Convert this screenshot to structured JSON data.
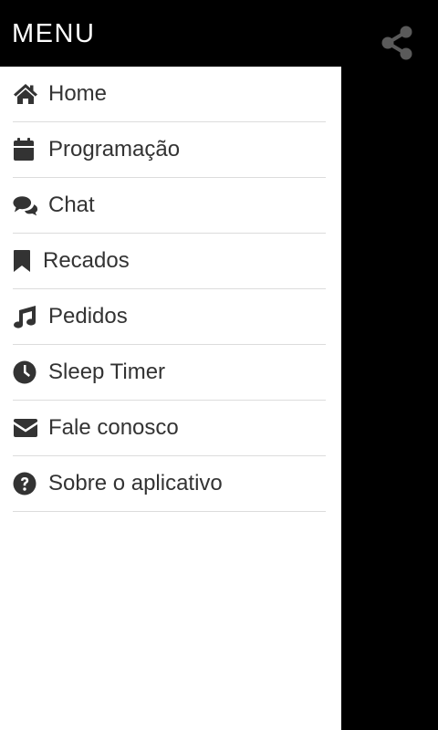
{
  "drawer": {
    "title": "MENU",
    "items": [
      {
        "label": "Home",
        "icon": "home-icon"
      },
      {
        "label": "Programação",
        "icon": "calendar-icon"
      },
      {
        "label": "Chat",
        "icon": "chat-icon"
      },
      {
        "label": "Recados",
        "icon": "bookmark-icon"
      },
      {
        "label": "Pedidos",
        "icon": "music-note-icon"
      },
      {
        "label": "Sleep Timer",
        "icon": "clock-icon"
      },
      {
        "label": "Fale conosco",
        "icon": "envelope-icon"
      },
      {
        "label": "Sobre o aplicativo",
        "icon": "help-circle-icon"
      }
    ]
  },
  "toolbar": {
    "share_icon": "share-icon"
  },
  "colors": {
    "header_bg": "#000000",
    "drawer_bg": "#ffffff",
    "text": "#333333",
    "divider": "#dcdcdc",
    "share_icon": "#5a5a5a"
  }
}
